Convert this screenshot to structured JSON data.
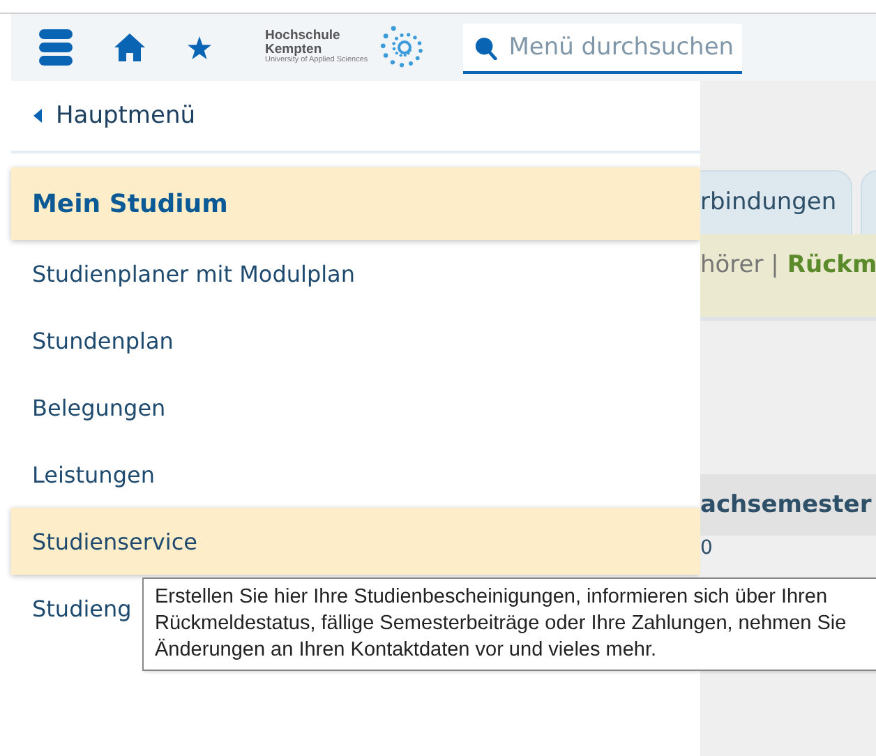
{
  "header": {
    "logo": {
      "name_line1": "Hochschule",
      "name_line2": "Kempten",
      "subtitle": "University of Applied Sciences"
    },
    "search": {
      "placeholder": "Menü durchsuchen"
    }
  },
  "menu": {
    "back": "Hauptmenü",
    "items": [
      {
        "label": "Mein Studium",
        "kind": "heading",
        "highlighted": true
      },
      {
        "label": "Studienplaner mit Modulplan",
        "kind": "link",
        "highlighted": false
      },
      {
        "label": "Stundenplan",
        "kind": "link",
        "highlighted": false
      },
      {
        "label": "Belegungen",
        "kind": "link",
        "highlighted": false
      },
      {
        "label": "Leistungen",
        "kind": "link",
        "highlighted": false
      },
      {
        "label": "Studienservice",
        "kind": "link",
        "highlighted": true
      },
      {
        "label": "Studieng",
        "kind": "link",
        "highlighted": false
      }
    ]
  },
  "tooltip": {
    "lines": [
      "Erstellen Sie hier Ihre Studienbescheinigungen, informieren sich über Ihren",
      "Rückmeldestatus, fällige Semesterbeiträge oder Ihre Zahlungen, nehmen Sie",
      "Änderungen an Ihren Kontaktdaten vor und vieles mehr."
    ]
  },
  "background_page": {
    "tabs": [
      {
        "label": "rbindungen"
      }
    ],
    "info_bar": {
      "text": "hörer |",
      "status": "Rückm"
    },
    "table": {
      "column_1": "achsemester",
      "rows": [
        "0"
      ]
    }
  }
}
